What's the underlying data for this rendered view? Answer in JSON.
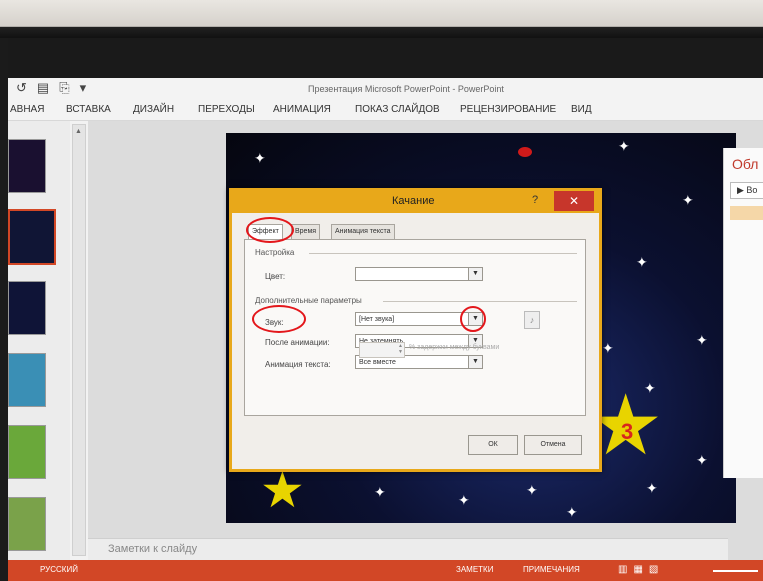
{
  "window": {
    "title": "Презентация Microsoft PowerPoint - PowerPoint"
  },
  "ribbon": {
    "tabs": [
      "АВНАЯ",
      "ВСТАВКА",
      "ДИЗАЙН",
      "ПЕРЕХОДЫ",
      "АНИМАЦИЯ",
      "ПОКАЗ СЛАЙДОВ",
      "РЕЦЕНЗИРОВАНИЕ",
      "ВИД"
    ]
  },
  "slide": {
    "star_number": "3"
  },
  "animation_pane": {
    "title": "Обл",
    "play_label": "▶ Во"
  },
  "notes": {
    "placeholder": "Заметки к слайду"
  },
  "status_bar": {
    "language": "РУССКИЙ",
    "notes": "ЗАМЕТКИ",
    "comments": "ПРИМЕЧАНИЯ"
  },
  "dialog": {
    "title": "Качание",
    "help": "?",
    "close": "✕",
    "tabs": [
      "Эффект",
      "Время",
      "Анимация текста"
    ],
    "group_settings": "Настройка",
    "color_label": "Цвет:",
    "color_value": "",
    "group_additional": "Дополнительные параметры",
    "sound_label": "Звук:",
    "sound_value": "[Нет звука]",
    "after_label": "После анимации:",
    "after_value": "Не затемнять",
    "text_anim_label": "Анимация текста:",
    "text_anim_value": "Все вместе",
    "delay_label": "% задержки между буквами",
    "ok": "ОК",
    "cancel": "Отмена"
  },
  "colors": {
    "accent": "#d24726",
    "dialog_frame": "#e8a81a",
    "close_button": "#c7362b",
    "annotation_circle": "#e3171b",
    "star_yellow": "#e8d400"
  },
  "icons": [
    "undo-icon",
    "save-icon",
    "preview-icon",
    "customize-icon",
    "close-icon",
    "chevron-down-icon",
    "speaker-icon",
    "spin-icon"
  ]
}
